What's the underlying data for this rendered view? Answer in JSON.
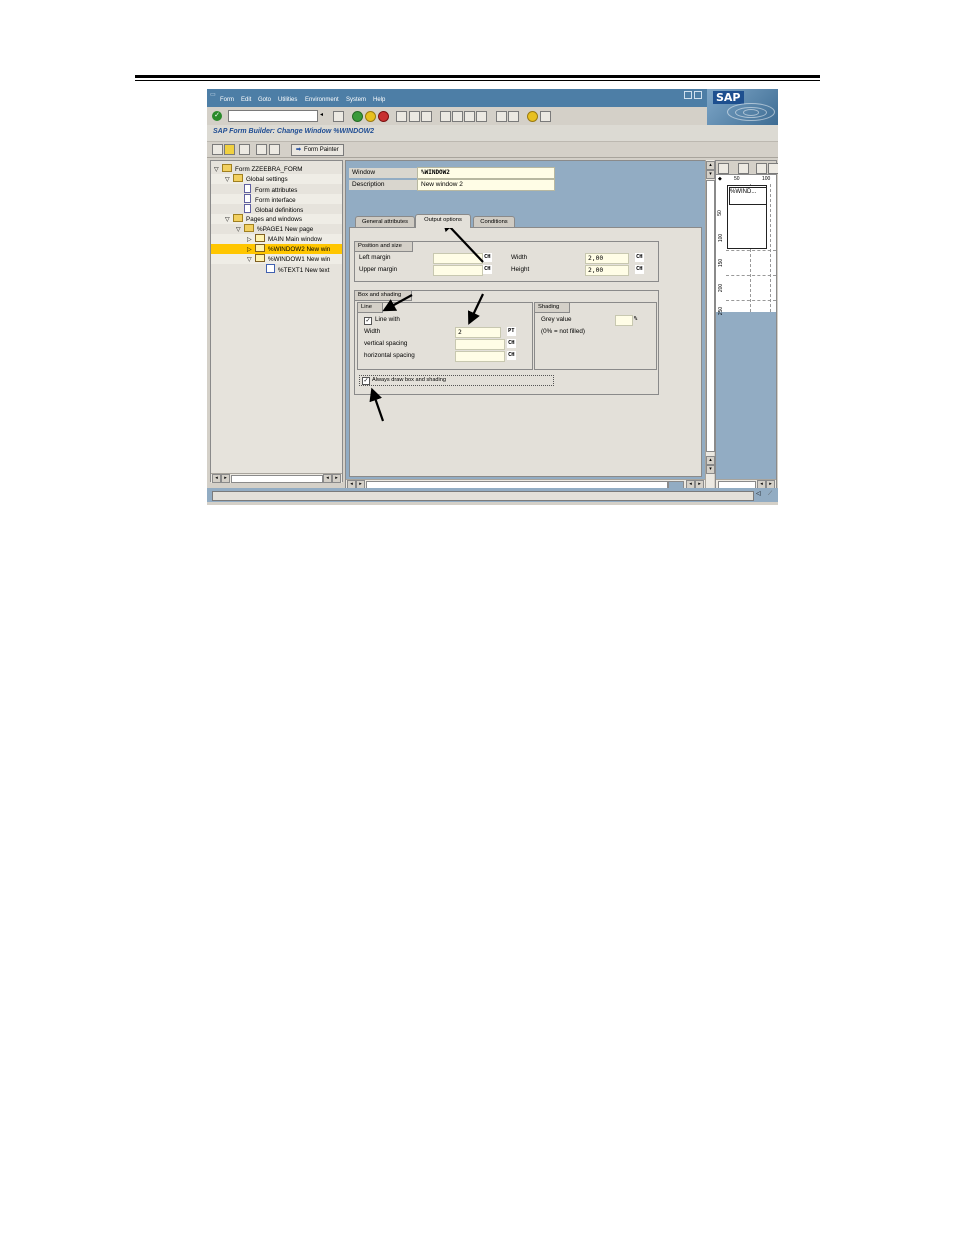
{
  "menu": {
    "items": [
      "Form",
      "Edit",
      "Goto",
      "Utilities",
      "Environment",
      "System",
      "Help"
    ],
    "logo": "SAP"
  },
  "title": "SAP Form Builder: Change Window %WINDOW2",
  "app_toolbar": {
    "form_painter": "Form Painter"
  },
  "tree": {
    "items": [
      {
        "label": "Form ZZEEBRA_FORM",
        "indent": 0,
        "toggle": "▽",
        "icon": "folder"
      },
      {
        "label": "Global settings",
        "indent": 1,
        "toggle": "▽",
        "icon": "folder"
      },
      {
        "label": "Form attributes",
        "indent": 2,
        "toggle": "",
        "icon": "doc"
      },
      {
        "label": "Form interface",
        "indent": 2,
        "toggle": "",
        "icon": "doc"
      },
      {
        "label": "Global definitions",
        "indent": 2,
        "toggle": "",
        "icon": "doc"
      },
      {
        "label": "Pages and windows",
        "indent": 1,
        "toggle": "▽",
        "icon": "folder"
      },
      {
        "label": "%PAGE1 New page",
        "indent": 2,
        "toggle": "▽",
        "icon": "folder"
      },
      {
        "label": "MAIN Main window",
        "indent": 3,
        "toggle": "▷",
        "icon": "window"
      },
      {
        "label": "%WINDOW2 New win",
        "indent": 3,
        "toggle": "▷",
        "icon": "window",
        "selected": true
      },
      {
        "label": "%WINDOW1 New win",
        "indent": 3,
        "toggle": "▽",
        "icon": "window"
      },
      {
        "label": "%TEXT1 New text",
        "indent": 4,
        "toggle": "",
        "icon": "text"
      }
    ]
  },
  "header": {
    "window_label": "Window",
    "window_value": "%WINDOW2",
    "description_label": "Description",
    "description_value": "New window 2"
  },
  "tabs": [
    {
      "label": "General attributes",
      "active": false
    },
    {
      "label": "Output options",
      "active": true
    },
    {
      "label": "Conditions",
      "active": false
    }
  ],
  "position_group": {
    "title": "Position and size",
    "left_margin_label": "Left margin",
    "left_margin_value": "",
    "left_margin_unit": "CH",
    "upper_margin_label": "Upper margin",
    "upper_margin_value": "",
    "upper_margin_unit": "CH",
    "width_label": "Width",
    "width_value": "2,00",
    "width_unit": "CH",
    "height_label": "Height",
    "height_value": "2,00",
    "height_unit": "CH"
  },
  "box_group": {
    "title": "Box and shading",
    "line": {
      "title": "Line",
      "line_with_label": "Line with",
      "line_with_checked": true,
      "width_label": "Width",
      "width_value": "2",
      "width_unit": "PT",
      "vertical_label": "vertical spacing",
      "vertical_unit": "CH",
      "horizontal_label": "horizontal spacing",
      "horizontal_unit": "CH"
    },
    "shading": {
      "title": "Shading",
      "grey_label": "Grey value",
      "grey_value": "",
      "grey_unit": "%",
      "note": "(0% = not filled)"
    },
    "always_label": "Always draw box and shading",
    "always_checked": true
  },
  "preview": {
    "ruler_h": [
      "50",
      "100"
    ],
    "ruler_v": [
      "50",
      "100",
      "150",
      "200",
      "250"
    ],
    "window_label": "%WIND..."
  },
  "colors": {
    "menubar": "#4d7ea6",
    "selected": "#ffc600",
    "pane_bg": "#92acc3",
    "title_text": "#1f4d93"
  }
}
